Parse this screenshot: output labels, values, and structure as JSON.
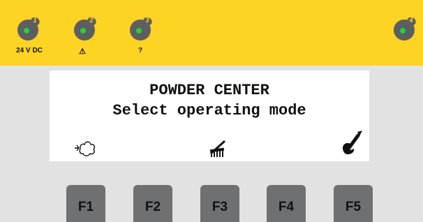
{
  "indicators": [
    {
      "number": "1",
      "label": "24 V DC"
    },
    {
      "number": "2",
      "label": "⚠"
    },
    {
      "number": "3",
      "label": "?"
    },
    {
      "number": "4",
      "label": ""
    }
  ],
  "display": {
    "title": "POWDER CENTER",
    "subtitle": "Select operating mode",
    "softkey_icons": [
      "cloud-icon",
      "rake-icon",
      "wrench-icon"
    ]
  },
  "function_keys": [
    "F1",
    "F2",
    "F3",
    "F4",
    "F5"
  ],
  "colors": {
    "panel_yellow": "#fdd324",
    "led_green": "#1ed43a",
    "led_housing": "#5d5e60",
    "key_gray": "#6f7072",
    "background": "#e2e2e2"
  }
}
